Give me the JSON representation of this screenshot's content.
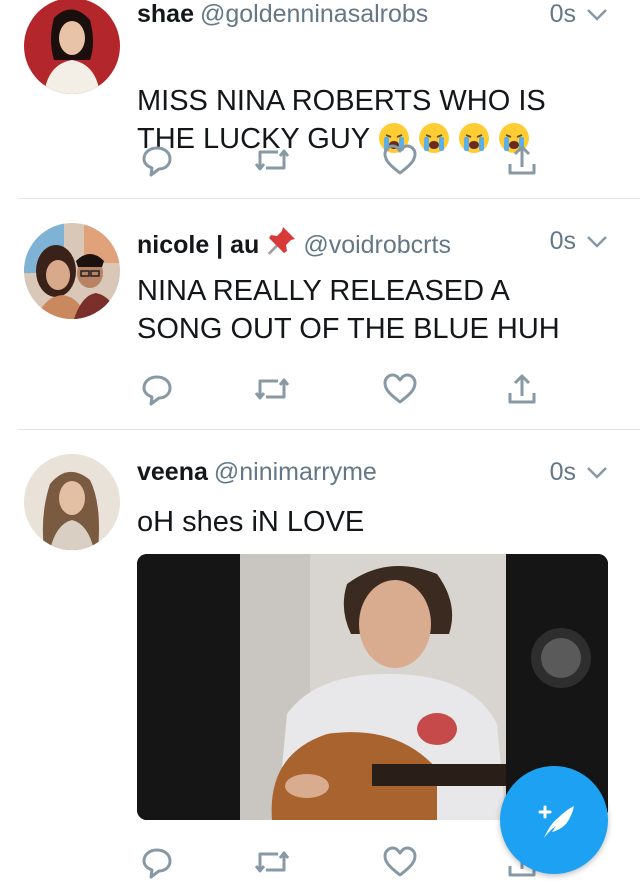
{
  "tweets": [
    {
      "name": "shae",
      "handle": "@goldenninasalrobs",
      "time": "0s",
      "text": "MISS NINA ROBERTS WHO IS\nTHE LUCKY GUY",
      "emoji_count": 4,
      "emoji_icon": "loudly-crying-face"
    },
    {
      "name": "nicole | au",
      "handle": "@voidrobcrts",
      "time": "0s",
      "text": "NINA REALLY RELEASED A\nSONG OUT OF THE BLUE HUH",
      "badge_icon": "pushpin-icon"
    },
    {
      "name": "veena",
      "handle": "@ninimarryme",
      "time": "0s",
      "text": "oH shes iN LOVE",
      "media": "video"
    }
  ],
  "colors": {
    "accent": "#1da1f2",
    "secondary_text": "#657786",
    "primary_text": "#14171a",
    "divider": "#e1e8ed"
  },
  "icons": [
    "reply-icon",
    "retweet-icon",
    "like-icon",
    "share-icon",
    "compose-tweet-icon"
  ]
}
